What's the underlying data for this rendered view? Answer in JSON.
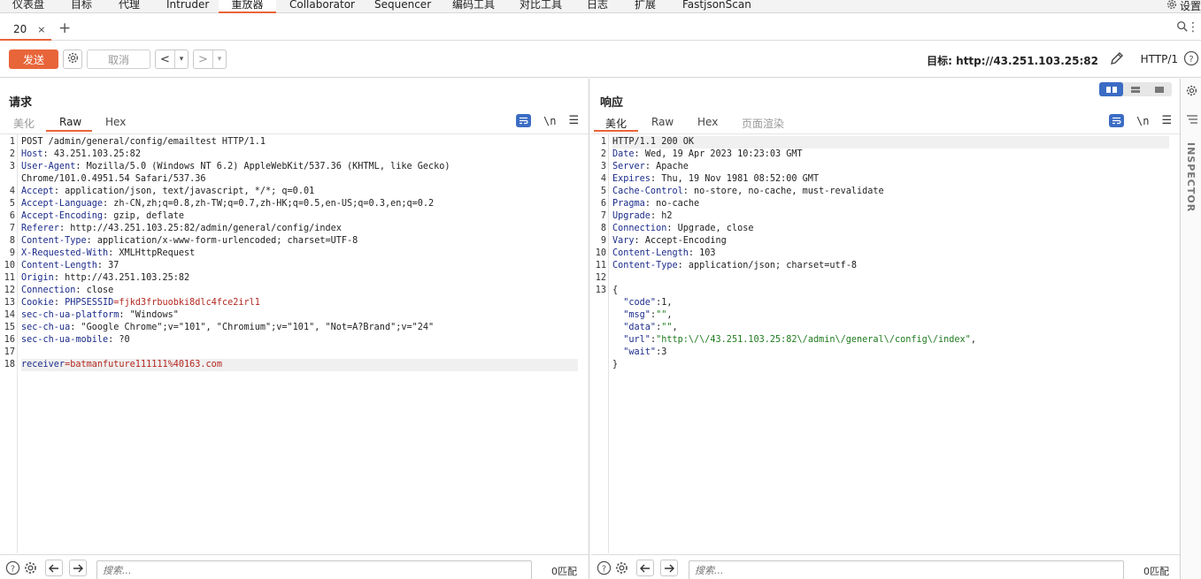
{
  "top_tabs": [
    {
      "label": "仪表盘",
      "active": false
    },
    {
      "label": "目标",
      "active": false
    },
    {
      "label": "代理",
      "active": false
    },
    {
      "label": "Intruder",
      "active": false
    },
    {
      "label": "重放器",
      "active": true
    },
    {
      "label": "Collaborator",
      "active": false
    },
    {
      "label": "Sequencer",
      "active": false
    },
    {
      "label": "编码工具",
      "active": false
    },
    {
      "label": "对比工具",
      "active": false
    },
    {
      "label": "日志",
      "active": false
    },
    {
      "label": "扩展",
      "active": false
    },
    {
      "label": "FastjsonScan",
      "active": false
    }
  ],
  "settings_label": "设置",
  "repeater_tab": {
    "label": "20",
    "close": "×"
  },
  "add_tab": "+",
  "toolbar": {
    "send": "发送",
    "cancel": "取消",
    "back": "<",
    "forward": ">",
    "dropdown": "▾",
    "target_label": "目标: http://43.251.103.25:82",
    "http_version": "HTTP/1"
  },
  "request": {
    "title": "请求",
    "tabs": [
      "美化",
      "Raw",
      "Hex"
    ],
    "active_tab": "Raw",
    "newline_toggle": "\\n",
    "lines": [
      {
        "n": "1",
        "k": "",
        "v": "POST /admin/general/config/emailtest HTTP/1.1"
      },
      {
        "n": "2",
        "k": "Host",
        "v": ": 43.251.103.25:82"
      },
      {
        "n": "3",
        "k": "User-Agent",
        "v": ": Mozilla/5.0 (Windows NT 6.2) AppleWebKit/537.36 (KHTML, like Gecko)"
      },
      {
        "n": "",
        "k": "",
        "v": "Chrome/101.0.4951.54 Safari/537.36"
      },
      {
        "n": "4",
        "k": "Accept",
        "v": ": application/json, text/javascript, */*; q=0.01"
      },
      {
        "n": "5",
        "k": "Accept-Language",
        "v": ": zh-CN,zh;q=0.8,zh-TW;q=0.7,zh-HK;q=0.5,en-US;q=0.3,en;q=0.2"
      },
      {
        "n": "6",
        "k": "Accept-Encoding",
        "v": ": gzip, deflate"
      },
      {
        "n": "7",
        "k": "Referer",
        "v": ": http://43.251.103.25:82/admin/general/config/index"
      },
      {
        "n": "8",
        "k": "Content-Type",
        "v": ": application/x-www-form-urlencoded; charset=UTF-8"
      },
      {
        "n": "9",
        "k": "X-Requested-With",
        "v": ": XMLHttpRequest"
      },
      {
        "n": "10",
        "k": "Content-Length",
        "v": ": 37"
      },
      {
        "n": "11",
        "k": "Origin",
        "v": ": http://43.251.103.25:82"
      },
      {
        "n": "12",
        "k": "Connection",
        "v": ": close"
      },
      {
        "n": "13",
        "k": "Cookie",
        "v": ": ",
        "ck": "PHPSESSID",
        "cv": "=fjkd3frbuobki8dlc4fce2irl1"
      },
      {
        "n": "14",
        "k": "sec-ch-ua-platform",
        "v": ": \"Windows\""
      },
      {
        "n": "15",
        "k": "sec-ch-ua",
        "v": ": \"Google Chrome\";v=\"101\", \"Chromium\";v=\"101\", \"Not=A?Brand\";v=\"24\""
      },
      {
        "n": "16",
        "k": "sec-ch-ua-mobile",
        "v": ": ?0"
      },
      {
        "n": "17",
        "k": "",
        "v": ""
      },
      {
        "n": "18",
        "k": "receiver",
        "v": "",
        "pv": "=batmanfuture111111%40163.com",
        "hl": true
      }
    ],
    "search_placeholder": "搜索...",
    "match_count": "0匹配"
  },
  "response": {
    "title": "响应",
    "tabs": [
      "美化",
      "Raw",
      "Hex",
      "页面渲染"
    ],
    "active_tab": "美化",
    "newline_toggle": "\\n",
    "lines": [
      {
        "n": "1",
        "k": "",
        "v": "HTTP/1.1 200 OK",
        "hl": true
      },
      {
        "n": "2",
        "k": "Date",
        "v": ": Wed, 19 Apr 2023 10:23:03 GMT"
      },
      {
        "n": "3",
        "k": "Server",
        "v": ": Apache"
      },
      {
        "n": "4",
        "k": "Expires",
        "v": ": Thu, 19 Nov 1981 08:52:00 GMT"
      },
      {
        "n": "5",
        "k": "Cache-Control",
        "v": ": no-store, no-cache, must-revalidate"
      },
      {
        "n": "6",
        "k": "Pragma",
        "v": ": no-cache"
      },
      {
        "n": "7",
        "k": "Upgrade",
        "v": ": h2"
      },
      {
        "n": "8",
        "k": "Connection",
        "v": ": Upgrade, close"
      },
      {
        "n": "9",
        "k": "Vary",
        "v": ": Accept-Encoding"
      },
      {
        "n": "10",
        "k": "Content-Length",
        "v": ": 103"
      },
      {
        "n": "11",
        "k": "Content-Type",
        "v": ": application/json; charset=utf-8"
      },
      {
        "n": "12",
        "k": "",
        "v": ""
      },
      {
        "n": "13",
        "k": "",
        "v": "{"
      },
      {
        "n": "",
        "k": "  \"code\"",
        "v": ":1,"
      },
      {
        "n": "",
        "k": "  \"msg\"",
        "v": ":",
        "s": "\"\"",
        "t": ","
      },
      {
        "n": "",
        "k": "  \"data\"",
        "v": ":",
        "s": "\"\"",
        "t": ","
      },
      {
        "n": "",
        "k": "  \"url\"",
        "v": ":",
        "s": "\"http:\\/\\/43.251.103.25:82\\/admin\\/general\\/config\\/index\"",
        "t": ","
      },
      {
        "n": "",
        "k": "  \"wait\"",
        "v": ":3"
      },
      {
        "n": "",
        "k": "",
        "v": "}"
      }
    ],
    "search_placeholder": "搜索...",
    "match_count": "0匹配"
  },
  "inspector_label": "INSPECTOR"
}
